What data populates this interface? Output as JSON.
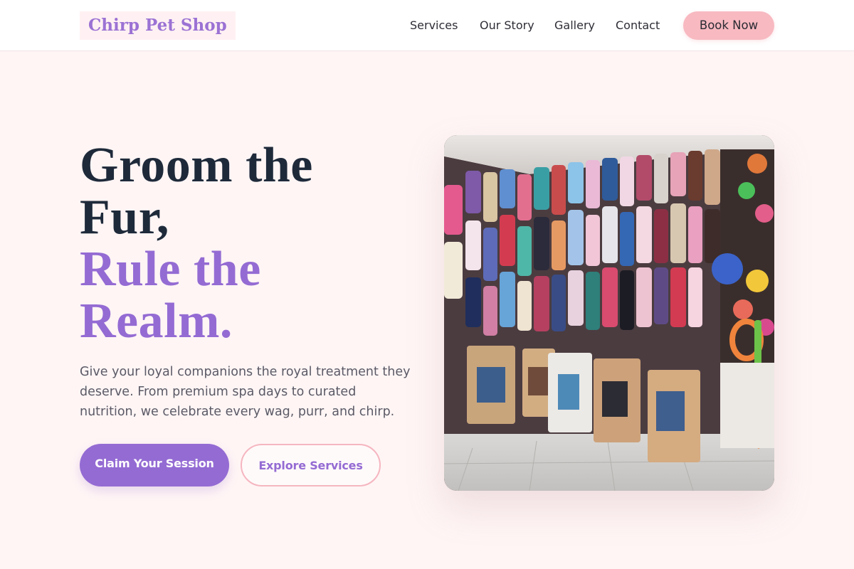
{
  "header": {
    "logo": "Chirp Pet Shop",
    "nav": [
      "Services",
      "Our Story",
      "Gallery",
      "Contact"
    ],
    "cta": "Book Now"
  },
  "hero": {
    "headline_line1": "Groom the",
    "headline_line2": "Fur,",
    "headline_accent1": "Rule the",
    "headline_accent2": "Realm.",
    "subtext": "Give your loyal companions the royal treatment they deserve. From premium spa days to curated nutrition, we celebrate every wag, purr, and chirp.",
    "primary_button": "Claim Your Session",
    "secondary_button": "Explore Services"
  },
  "image": {
    "subject": "pet-shop-interior-photo"
  },
  "colors": {
    "accent_purple": "#946bd3",
    "accent_pink": "#f8b9c1",
    "page_background": "#fff5f5",
    "headline_dark": "#1e2a3a"
  }
}
